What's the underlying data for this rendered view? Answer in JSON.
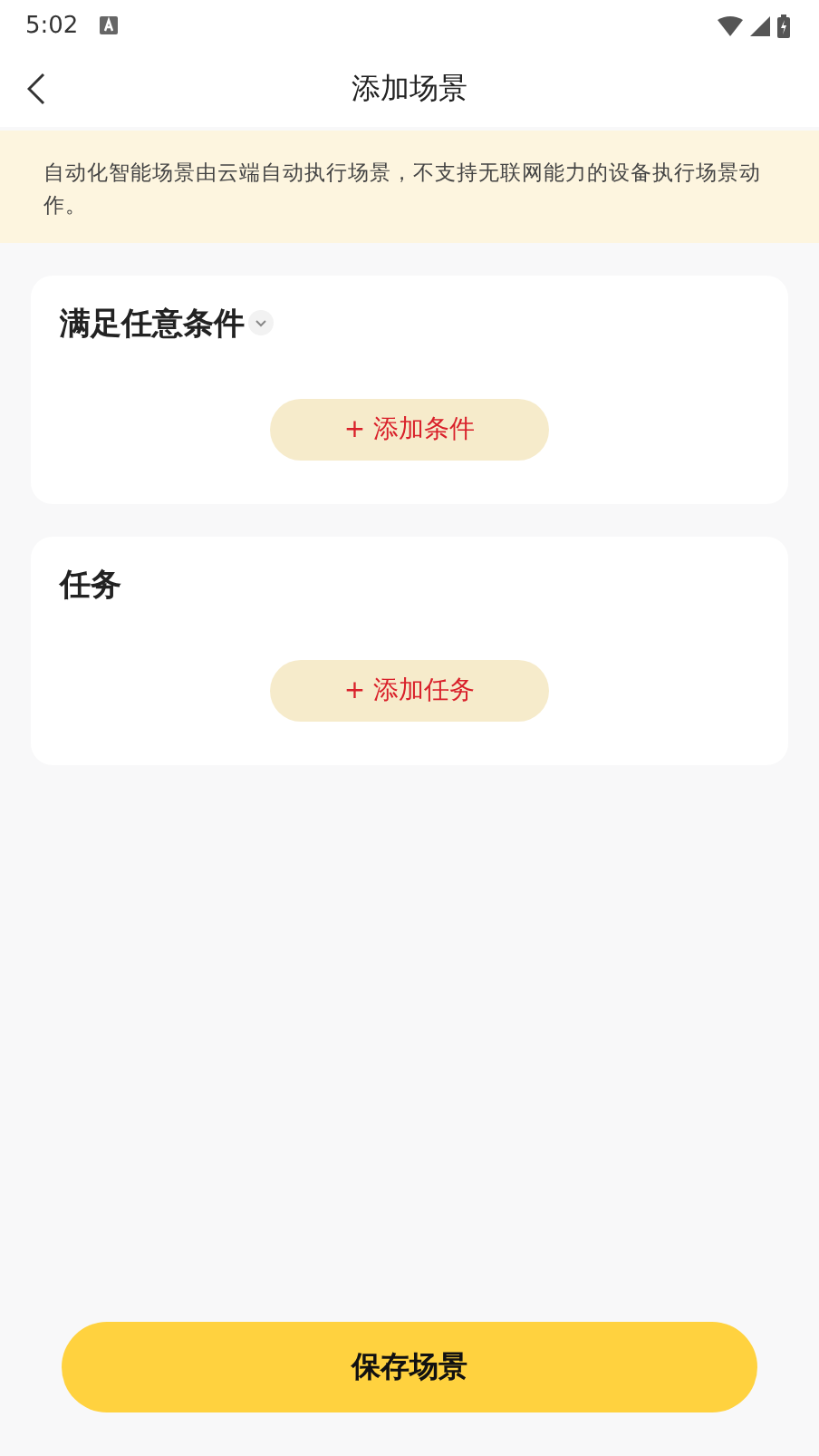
{
  "status_bar": {
    "time": "5:02"
  },
  "header": {
    "title": "添加场景"
  },
  "notice": {
    "text": "自动化智能场景由云端自动执行场景，不支持无联网能力的设备执行场景动作。"
  },
  "sections": [
    {
      "title": "满足任意条件",
      "has_dropdown": true,
      "button": "+ 添加条件"
    },
    {
      "title": "任务",
      "has_dropdown": false,
      "button": "+ 添加任务"
    }
  ],
  "save_button": "保存场景"
}
